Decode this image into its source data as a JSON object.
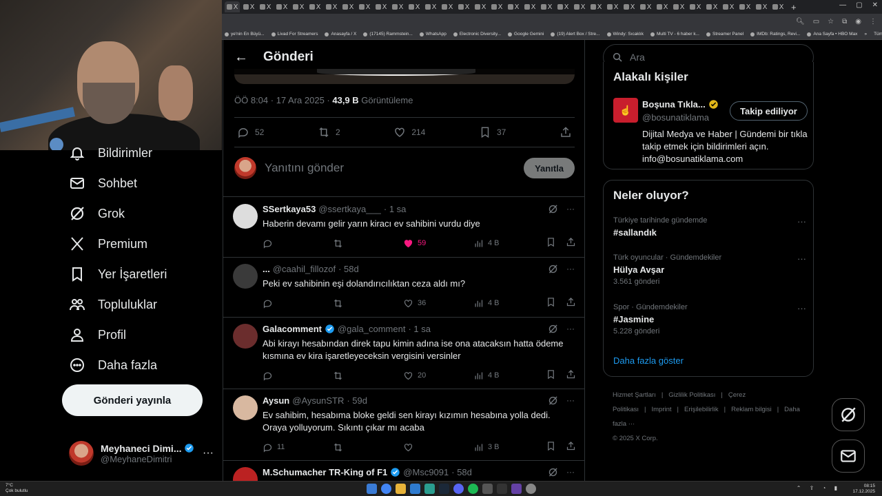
{
  "browser": {
    "tab_glyph": "X",
    "new_tab": "+",
    "bookmarks": [
      "ye'nin En Büyü...",
      "Livad For Streamers",
      "Anasayfa / X",
      "(17145) Rammstein...",
      "WhatsApp",
      "Electronic Diversity...",
      "Google Gemini",
      "(19) Alert Box / Stre...",
      "Windy: Sıcaklık",
      "Multi TV - 6 haber k...",
      "Streamer Panel",
      "IMDb: Ratings, Revi...",
      "Ana Sayfa • HBO Max"
    ],
    "bookmarks_more": "»",
    "bookmarks_all": "Tüm Yer İşaretleri"
  },
  "nav": {
    "items": [
      {
        "label": "Bildirimler",
        "icon": "bell-icon"
      },
      {
        "label": "Sohbet",
        "icon": "mail-icon"
      },
      {
        "label": "Grok",
        "icon": "grok-icon"
      },
      {
        "label": "Premium",
        "icon": "x-logo-icon"
      },
      {
        "label": "Yer İşaretleri",
        "icon": "bookmark-icon"
      },
      {
        "label": "Topluluklar",
        "icon": "people-icon"
      },
      {
        "label": "Profil",
        "icon": "person-icon"
      },
      {
        "label": "Daha fazla",
        "icon": "more-circle-icon"
      }
    ],
    "post_button": "Gönderi yayınla",
    "account": {
      "name": "Meyhaneci Dimi...",
      "handle": "@MeyhaneDimitri",
      "more": "···"
    }
  },
  "post": {
    "header_title": "Gönderi",
    "back": "←",
    "time": "ÖÖ 8:04 · 17 Ara 2025 · ",
    "views_value": "43,9 B",
    "views_label": " Görüntüleme",
    "stats": {
      "replies": "52",
      "reposts": "2",
      "likes": "214",
      "bookmarks": "37"
    },
    "reply_placeholder": "Yanıtını gönder",
    "reply_button": "Yanıtla"
  },
  "replies": [
    {
      "name": "SSertkaya53",
      "handle": "@ssertkaya___",
      "time": "· 1 sa",
      "verified": false,
      "text": "Haberin devamı gelir yarın kiracı ev sahibini vurdu diye",
      "replies": "",
      "reposts": "",
      "likes": "59",
      "liked": true,
      "views": "4 B"
    },
    {
      "name": "...",
      "handle": "@caahil_fillozof",
      "time": "· 58d",
      "verified": false,
      "text": "Peki ev sahibinin eşi dolandırıcılıktan ceza aldı mı?",
      "replies": "",
      "reposts": "",
      "likes": "36",
      "liked": false,
      "views": "4 B"
    },
    {
      "name": "Galacomment",
      "handle": "@gala_comment",
      "time": "· 1 sa",
      "verified": true,
      "text": "Abi kirayı hesabından direk tapu kimin adına ise ona atacaksın hatta ödeme kısmına ev kira işaretleyeceksin vergisini versinler",
      "replies": "",
      "reposts": "",
      "likes": "20",
      "liked": false,
      "views": "4 B"
    },
    {
      "name": "Aysun",
      "handle": "@AysunSTR",
      "time": "· 59d",
      "verified": false,
      "text": "Ev sahibim, hesabıma bloke geldi sen kirayı kızımın hesabına yolla dedi. Oraya yolluyorum. Sıkıntı çıkar mı acaba",
      "replies": "11",
      "reposts": "",
      "likes": "",
      "liked": false,
      "views": "3 B"
    },
    {
      "name": "M.Schumacher TR-King of F1",
      "handle": "@Msc9091",
      "time": "· 58d",
      "verified": true,
      "text": "",
      "replies": "",
      "reposts": "",
      "likes": "",
      "liked": false,
      "views": ""
    }
  ],
  "right": {
    "search_placeholder": "Ara",
    "related_title": "Alakalı kişiler",
    "related": {
      "name": "Boşuna Tıkla...",
      "handle": "@bosunatiklama",
      "follow": "Takip ediliyor",
      "bio": "Dijital Medya ve Haber | Gündemi bir tıkla takip etmek için bildirimleri açın. info@bosunatiklama.com"
    },
    "trends_title": "Neler oluyor?",
    "trends": [
      {
        "context": "Türkiye tarihinde gündemde",
        "title": "#sallandık",
        "count": ""
      },
      {
        "context": "Türk oyuncular · Gündemdekiler",
        "title": "Hülya Avşar",
        "count": "3.561 gönderi"
      },
      {
        "context": "Spor · Gündemdekiler",
        "title": "#Jasmine",
        "count": "5.228 gönderi"
      }
    ],
    "show_more": "Daha fazla göster",
    "footer": [
      "Hizmet Şartları",
      "|",
      "Gizlilik Politikası",
      "|",
      "Çerez Politikası",
      "|",
      "Imprint",
      "|",
      "Erişilebilirlik",
      "|",
      "Reklam bilgisi",
      "|",
      "Daha fazla ···",
      "© 2025 X Corp."
    ]
  },
  "taskbar": {
    "weather_temp": "7°C",
    "weather_desc": "Çok bulutlu",
    "time": "08:15",
    "date": "17.12.2025"
  },
  "colors": {
    "accent": "#1d9bf0",
    "like": "#f91880",
    "bg": "#000000",
    "border": "#2f3336"
  }
}
